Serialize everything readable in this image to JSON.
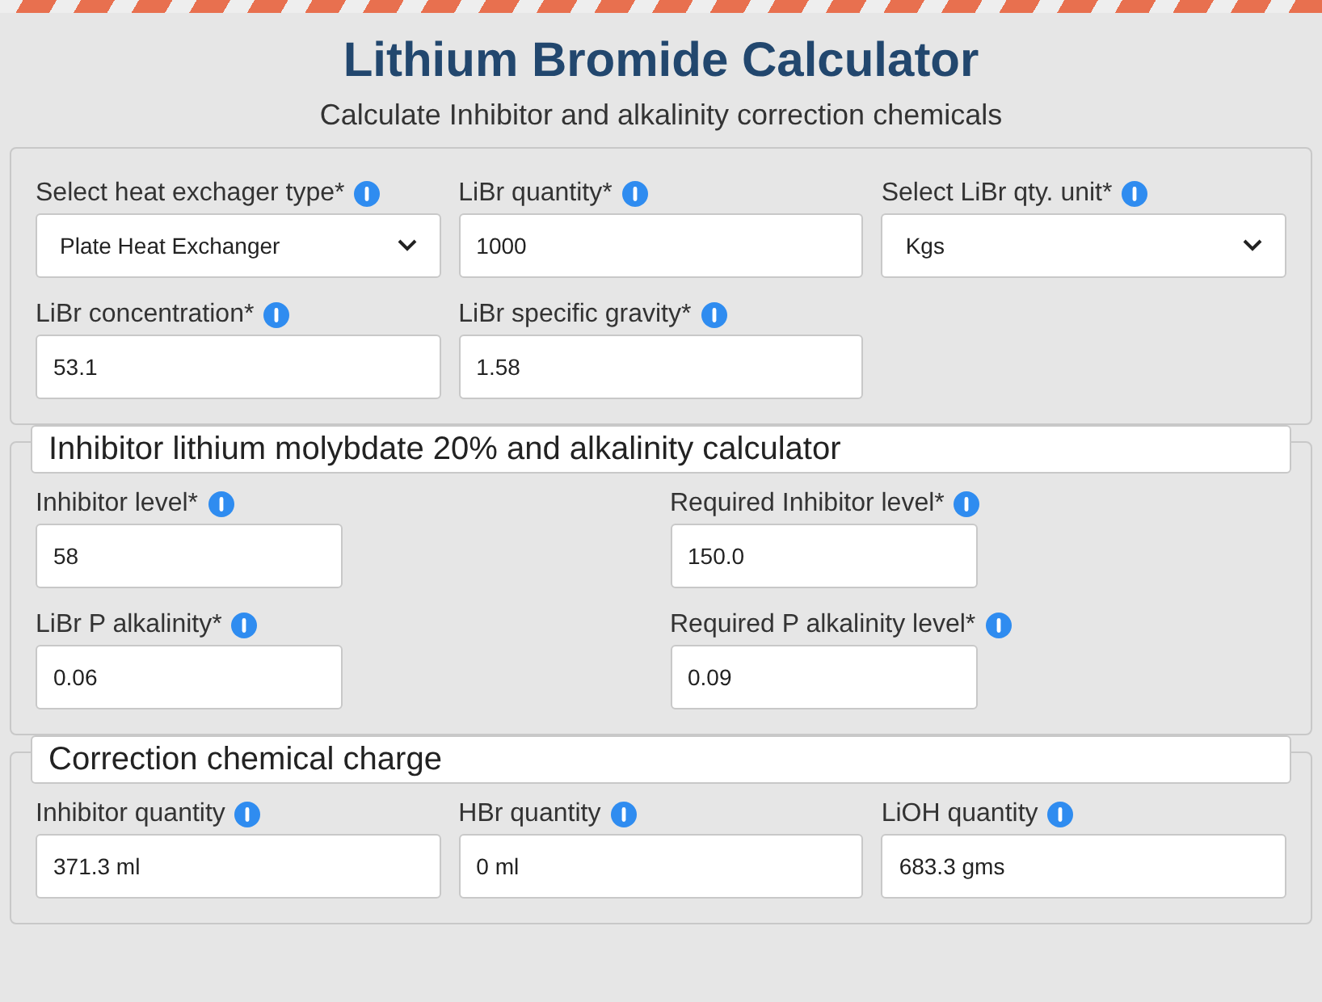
{
  "header": {
    "title": "Lithium Bromide Calculator",
    "subtitle": "Calculate Inhibitor and alkalinity correction chemicals"
  },
  "sections": [
    {
      "fields": [
        {
          "label": "Select heat exchager type*",
          "value": "Plate Heat Exchanger",
          "kind": "select"
        },
        {
          "label": "LiBr quantity*",
          "value": "1000",
          "kind": "input"
        },
        {
          "label": "Select LiBr qty. unit*",
          "value": "Kgs",
          "kind": "select"
        },
        {
          "label": "LiBr concentration*",
          "value": "53.1",
          "kind": "input"
        },
        {
          "label": "LiBr specific gravity*",
          "value": "1.58",
          "kind": "input"
        }
      ]
    },
    {
      "legend": "Inhibitor lithium molybdate 20% and alkalinity calculator",
      "fields": [
        {
          "label": "Inhibitor level*",
          "value": "58",
          "kind": "input"
        },
        {
          "label": "Required Inhibitor level*",
          "value": "150.0",
          "kind": "input"
        },
        {
          "label": "LiBr P alkalinity*",
          "value": "0.06",
          "kind": "input"
        },
        {
          "label": "Required P alkalinity level*",
          "value": "0.09",
          "kind": "input"
        }
      ]
    },
    {
      "legend": "Correction chemical charge",
      "fields": [
        {
          "label": "Inhibitor quantity",
          "value": "371.3 ml",
          "kind": "input"
        },
        {
          "label": "HBr quantity",
          "value": "0 ml",
          "kind": "input"
        },
        {
          "label": "LiOH quantity",
          "value": "683.3 gms",
          "kind": "input"
        }
      ]
    }
  ]
}
